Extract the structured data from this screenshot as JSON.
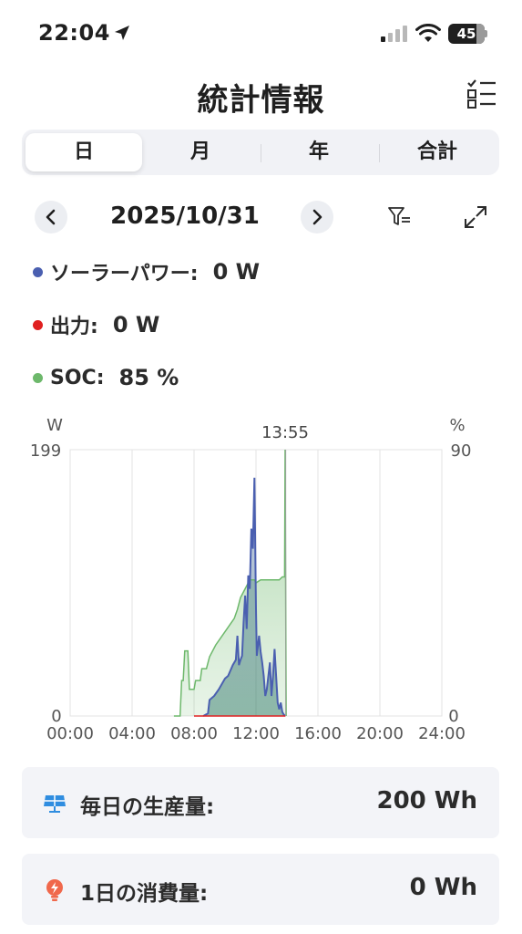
{
  "status_bar": {
    "time": "22:04",
    "battery": "45"
  },
  "header": {
    "title": "統計情報"
  },
  "tabs": [
    {
      "label": "日",
      "active": true
    },
    {
      "label": "月",
      "active": false
    },
    {
      "label": "年",
      "active": false
    },
    {
      "label": "合計",
      "active": false
    }
  ],
  "date_nav": {
    "date": "2025/10/31"
  },
  "legend": {
    "solar": {
      "label": "ソーラーパワー:",
      "value": "0 W",
      "color": "#4a5fb0"
    },
    "output": {
      "label": "出力:",
      "value": "0 W",
      "color": "#e02020"
    },
    "soc": {
      "label": "SOC:",
      "value": "85 %",
      "color": "#6db86b"
    }
  },
  "chart_data": {
    "type": "line",
    "left_unit": "W",
    "right_unit": "%",
    "left_max_label": "199",
    "left_min_label": "0",
    "right_max_label": "90",
    "right_min_label": "0",
    "cursor_label": "13:55",
    "x_tick_labels": [
      "00:00",
      "04:00",
      "08:00",
      "12:00",
      "16:00",
      "20:00",
      "24:00"
    ],
    "xlim_hours": [
      0,
      24
    ],
    "ylim_left": [
      0,
      199
    ],
    "ylim_right": [
      0,
      90
    ],
    "cursor_hour": 13.92,
    "grid": true,
    "series": [
      {
        "name": "ソーラーパワー",
        "axis": "left",
        "color": "#4a5fb0",
        "points": [
          [
            8.6,
            0
          ],
          [
            8.9,
            2
          ],
          [
            9.0,
            12
          ],
          [
            9.3,
            15
          ],
          [
            9.6,
            20
          ],
          [
            10.0,
            28
          ],
          [
            10.2,
            30
          ],
          [
            10.5,
            38
          ],
          [
            10.7,
            42
          ],
          [
            10.8,
            60
          ],
          [
            10.9,
            38
          ],
          [
            11.0,
            42
          ],
          [
            11.1,
            45
          ],
          [
            11.2,
            70
          ],
          [
            11.3,
            90
          ],
          [
            11.4,
            65
          ],
          [
            11.5,
            105
          ],
          [
            11.6,
            95
          ],
          [
            11.7,
            140
          ],
          [
            11.8,
            125
          ],
          [
            11.9,
            178
          ],
          [
            12.0,
            80
          ],
          [
            12.05,
            45
          ],
          [
            12.2,
            60
          ],
          [
            12.3,
            48
          ],
          [
            12.4,
            40
          ],
          [
            12.5,
            30
          ],
          [
            12.6,
            15
          ],
          [
            12.7,
            20
          ],
          [
            12.8,
            30
          ],
          [
            12.9,
            40
          ],
          [
            13.0,
            15
          ],
          [
            13.1,
            30
          ],
          [
            13.2,
            50
          ],
          [
            13.3,
            30
          ],
          [
            13.4,
            10
          ],
          [
            13.5,
            5
          ],
          [
            13.6,
            10
          ],
          [
            13.7,
            3
          ],
          [
            13.8,
            1
          ],
          [
            13.9,
            0
          ]
        ]
      },
      {
        "name": "出力",
        "axis": "left",
        "color": "#e02020",
        "points": [
          [
            8.0,
            0
          ],
          [
            13.9,
            0
          ]
        ]
      },
      {
        "name": "SOC",
        "axis": "right",
        "color": "#6db86b",
        "points": [
          [
            6.7,
            0
          ],
          [
            7.1,
            0
          ],
          [
            7.2,
            12
          ],
          [
            7.3,
            12
          ],
          [
            7.4,
            22
          ],
          [
            7.6,
            22
          ],
          [
            7.7,
            9
          ],
          [
            8.0,
            9
          ],
          [
            8.1,
            12
          ],
          [
            8.4,
            12
          ],
          [
            8.5,
            16
          ],
          [
            8.8,
            16
          ],
          [
            9.0,
            20
          ],
          [
            9.4,
            24
          ],
          [
            9.8,
            27
          ],
          [
            10.2,
            30
          ],
          [
            10.6,
            33
          ],
          [
            10.8,
            36
          ],
          [
            11.0,
            40
          ],
          [
            11.3,
            43
          ],
          [
            11.6,
            46
          ],
          [
            11.9,
            46
          ],
          [
            12.0,
            45
          ],
          [
            12.3,
            46
          ],
          [
            13.5,
            46
          ],
          [
            13.7,
            47
          ],
          [
            13.85,
            47
          ],
          [
            13.88,
            90
          ],
          [
            13.95,
            0
          ]
        ]
      }
    ]
  },
  "summary": {
    "production": {
      "label": "毎日の生産量:",
      "value": "200 Wh"
    },
    "consumption": {
      "label": "1日の消費量:",
      "value": "0 Wh"
    }
  }
}
